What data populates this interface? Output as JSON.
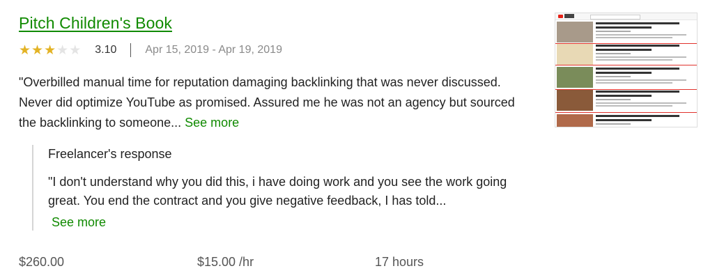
{
  "job": {
    "title": "Pitch Children's Book",
    "rating_value": 3.1,
    "rating_label": "3.10",
    "stars_filled": 3,
    "stars_total": 5,
    "date_range": "Apr 15, 2019 - Apr 19, 2019",
    "review": "\"Overbilled manual time for reputation damaging backlinking that was never discussed. Never did optimize YouTube as promised. Assured me he was not an agency but sourced the backlinking to someone...",
    "see_more": "See more"
  },
  "response": {
    "heading": "Freelancer's response",
    "text": "\"I don't understand why you did this, i have doing work and you see the work going great. You end the contract and you give negative feedback, I has told...",
    "see_more": "See more"
  },
  "stats": {
    "total": "$260.00",
    "rate": "$15.00 /hr",
    "hours": "17 hours"
  },
  "thumbnail": {
    "icon": "youtube-search-results-thumbnail",
    "highlight_color": "#e0322c"
  },
  "colors": {
    "accent_green": "#108a00",
    "star_gold": "#e3b325",
    "star_empty": "#e4e4e4"
  }
}
